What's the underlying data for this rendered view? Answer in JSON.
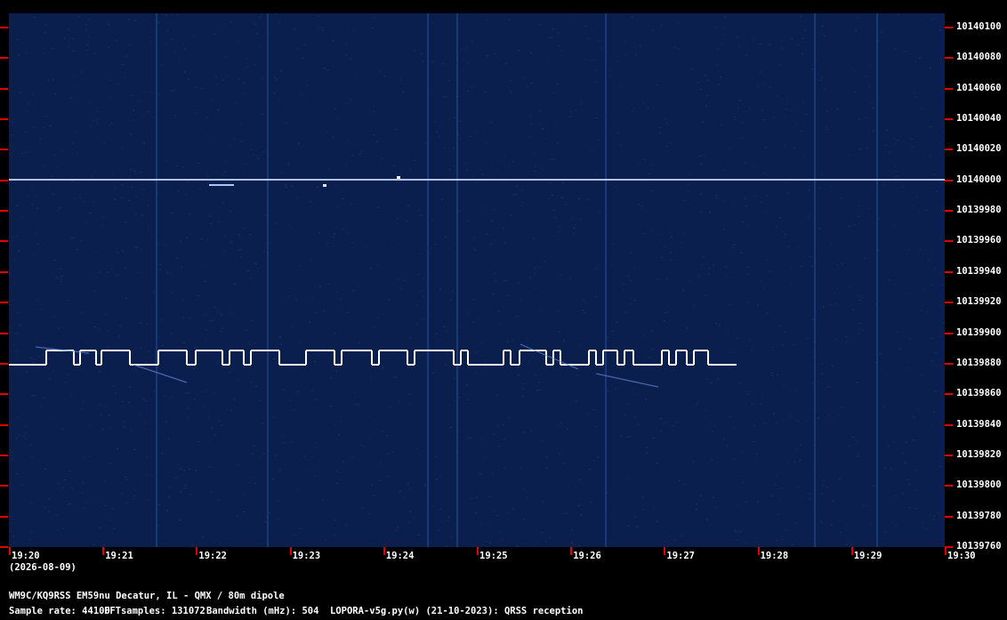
{
  "y_axis": {
    "labels": [
      "10140100",
      "10140080",
      "10140060",
      "10140040",
      "10140020",
      "10140000",
      "10139980",
      "10139960",
      "10139940",
      "10139920",
      "10139900",
      "10139880",
      "10139860",
      "10139840",
      "10139820",
      "10139800",
      "10139780",
      "10139760"
    ]
  },
  "x_axis": {
    "labels": [
      "19:20",
      "19:21",
      "19:22",
      "19:23",
      "19:24",
      "19:25",
      "19:26",
      "19:27",
      "19:28",
      "19:29",
      "19:30"
    ],
    "date": "(2026-08-09)"
  },
  "footer": {
    "station": "WM9C/KQ9RSS EM59nu Decatur, IL - QMX / 80m dipole",
    "sample_rate": "Sample rate: 44100",
    "fft_samples": "FFTsamples: 131072",
    "bandwidth": "Bandwidth (mHz): 504",
    "software": "LOPORA-v5g.py(w) (21-10-2023): QRSS reception"
  },
  "colors": {
    "background": "#000000",
    "waterfall": "#0b1f4e",
    "tick": "#e00000",
    "signal": "#ffffff"
  }
}
